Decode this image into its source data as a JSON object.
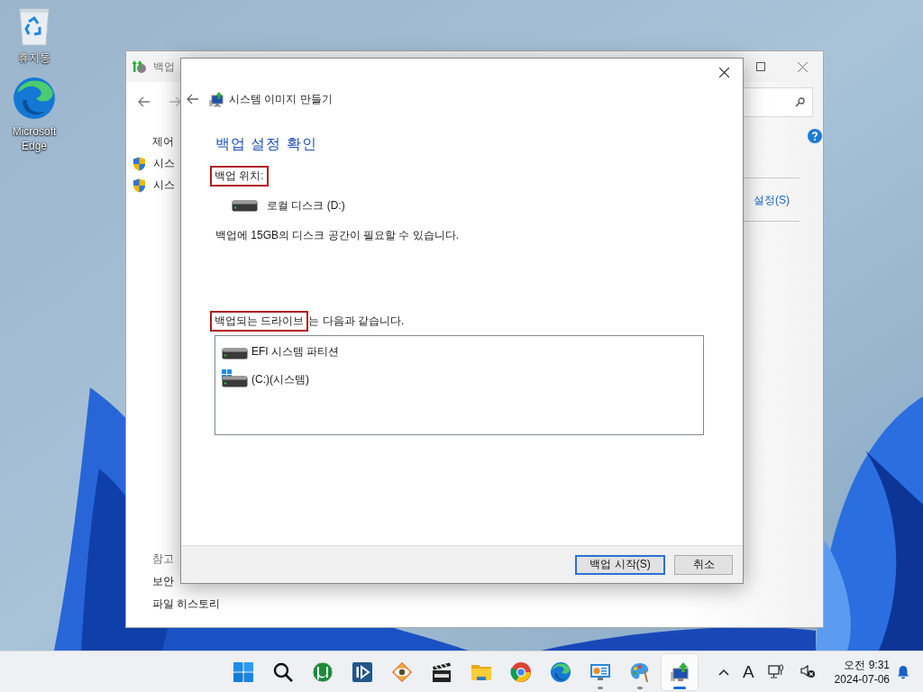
{
  "desktop": {
    "icons": [
      {
        "kind": "recycle-bin",
        "label": "휴지통"
      },
      {
        "kind": "edge",
        "label": "Microsoft Edge"
      }
    ]
  },
  "back_window": {
    "title": "백업",
    "nav_heading": "제어",
    "tasks": [
      "시스",
      "시스"
    ],
    "see_also": "참고",
    "links": [
      "보안",
      "파일 히스토리"
    ],
    "right_link": "설정(S)"
  },
  "dialog": {
    "title": "시스템 이미지 만들기",
    "heading": "백업 설정 확인",
    "location_label": {
      "text": "백업 위치:",
      "highlighted": true
    },
    "location": "로컬 디스크 (D:)",
    "space_note": "백업에 15GB의 디스크 공간이 필요할 수 있습니다.",
    "drives_label": {
      "highlighted": "백업되는 드라이브",
      "rest": "는 다음과 같습니다."
    },
    "drives": [
      {
        "kind": "partition",
        "label": "EFI 시스템 파티션"
      },
      {
        "kind": "system",
        "label": "(C:)(시스템)"
      }
    ],
    "buttons": [
      {
        "label": "백업 시작(S)",
        "default": true
      },
      {
        "label": "취소",
        "default": false
      }
    ]
  },
  "taskbar": {
    "apps": [
      {
        "kind": "start",
        "running": false,
        "selected": false
      },
      {
        "kind": "search",
        "running": false,
        "selected": false
      },
      {
        "kind": "torrent",
        "running": false,
        "selected": false
      },
      {
        "kind": "player",
        "running": false,
        "selected": false
      },
      {
        "kind": "eye",
        "running": false,
        "selected": false
      },
      {
        "kind": "clapper",
        "running": false,
        "selected": false
      },
      {
        "kind": "folder",
        "running": false,
        "selected": false
      },
      {
        "kind": "chrome",
        "running": false,
        "selected": false
      },
      {
        "kind": "edge",
        "running": false,
        "selected": false
      },
      {
        "kind": "control-panel",
        "running": true,
        "selected": false
      },
      {
        "kind": "paint",
        "running": true,
        "selected": false
      },
      {
        "kind": "backup",
        "running": true,
        "selected": true
      }
    ],
    "input_mode": "A",
    "time": "오전 9:31",
    "date": "2024-07-06"
  }
}
